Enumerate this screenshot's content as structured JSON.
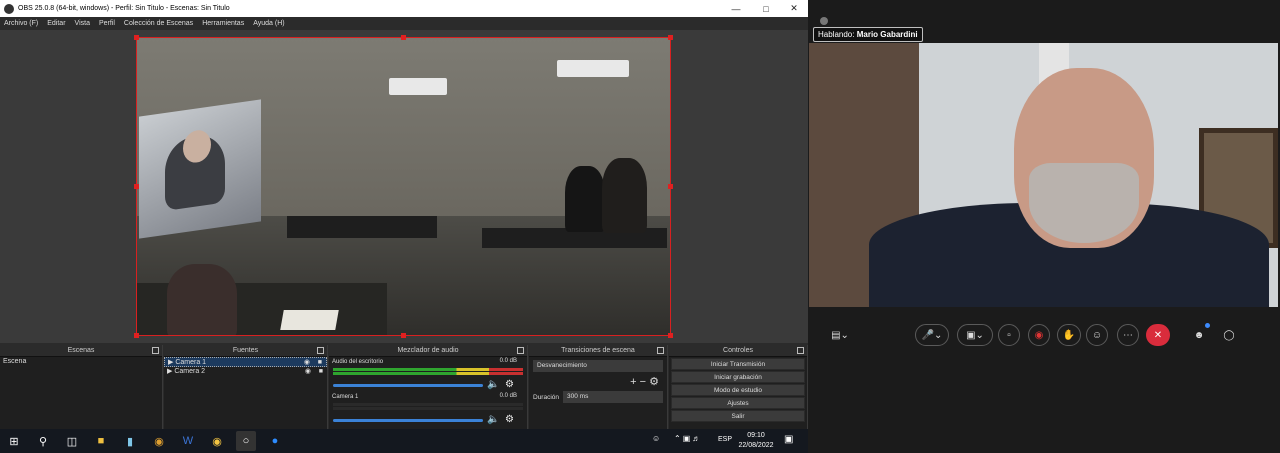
{
  "obs": {
    "title": "OBS 25.0.8 (64-bit, windows) - Perfil: Sin Titulo - Escenas: Sin Titulo",
    "menu": [
      "Archivo (F)",
      "Editar",
      "Vista",
      "Perfil",
      "Colección de Escenas",
      "Herramientas",
      "Ayuda (H)"
    ],
    "docks": {
      "scenes": {
        "title": "Escenas",
        "items": [
          "Escena"
        ]
      },
      "sources": {
        "title": "Fuentes",
        "items": [
          "Camera 1",
          "Camera 2"
        ]
      },
      "mixer": {
        "title": "Mezclador de audio",
        "channels": [
          {
            "name": "Audio del escritorio",
            "db": "0.0 dB"
          },
          {
            "name": "Camera 1",
            "db": "0.0 dB"
          }
        ]
      },
      "transitions": {
        "title": "Transiciones de escena",
        "selected": "Desvanecimiento",
        "duration_label": "Duración",
        "duration_value": "300 ms"
      },
      "controls": {
        "title": "Controles",
        "buttons": [
          "Iniciar Transmisión",
          "Iniciar grabación",
          "Modo de estudio",
          "Ajustes",
          "Salir"
        ]
      }
    }
  },
  "taskbar": {
    "lang": "ESP",
    "time": "09:10",
    "date": "22/08/2022",
    "icons": [
      "windows-start-icon",
      "search-icon",
      "task-view-icon",
      "file-explorer-icon",
      "notes-icon",
      "chrome-icon",
      "word-icon",
      "app-icon",
      "obs-icon",
      "zoom-icon"
    ]
  },
  "zoom": {
    "speaker_prefix": "Hablando:",
    "speaker_name": "Mario Gabardini"
  }
}
